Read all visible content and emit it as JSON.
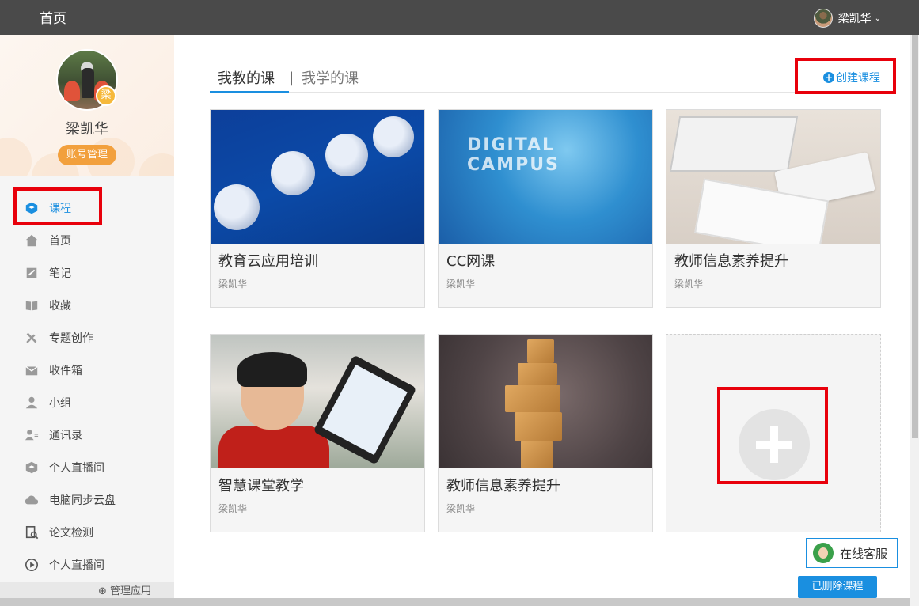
{
  "topbar": {
    "home": "首页",
    "username": "梁凯华",
    "caret": "⌄"
  },
  "sidebar": {
    "username": "梁凯华",
    "avatar_badge": "梁",
    "account_button": "账号管理",
    "items": [
      {
        "label": "课程",
        "icon": "course-icon",
        "active": true
      },
      {
        "label": "首页",
        "icon": "home-icon"
      },
      {
        "label": "笔记",
        "icon": "note-icon"
      },
      {
        "label": "收藏",
        "icon": "book-icon"
      },
      {
        "label": "专题创作",
        "icon": "pencil-ruler-icon"
      },
      {
        "label": "收件箱",
        "icon": "inbox-icon"
      },
      {
        "label": "小组",
        "icon": "person-icon"
      },
      {
        "label": "通讯录",
        "icon": "contacts-icon"
      },
      {
        "label": "个人直播间",
        "icon": "live-cube-icon"
      },
      {
        "label": "电脑同步云盘",
        "icon": "cloud-icon"
      },
      {
        "label": "论文检测",
        "icon": "paper-check-icon"
      },
      {
        "label": "个人直播间",
        "icon": "play-circle-icon"
      }
    ],
    "manage_apps": "管理应用"
  },
  "main": {
    "tabs": {
      "teach": "我教的课",
      "separator": "|",
      "learn": "我学的课"
    },
    "create_course": "创建课程",
    "courses": [
      {
        "title": "教育云应用培训",
        "teacher": "梁凯华"
      },
      {
        "title": "CC网课",
        "teacher": "梁凯华",
        "thumb_text": "DIGITAL CAMPUS"
      },
      {
        "title": "教师信息素养提升",
        "teacher": "梁凯华"
      },
      {
        "title": "智慧课堂教学",
        "teacher": "梁凯华"
      },
      {
        "title": "教师信息素养提升",
        "teacher": "梁凯华"
      }
    ]
  },
  "floating": {
    "online_service": "在线客服",
    "deleted_courses": "已删除课程"
  },
  "colors": {
    "accent": "#1a8fe0",
    "highlight": "#e8000b",
    "account_button": "#f2a03d",
    "topbar": "#4a4a4a"
  }
}
